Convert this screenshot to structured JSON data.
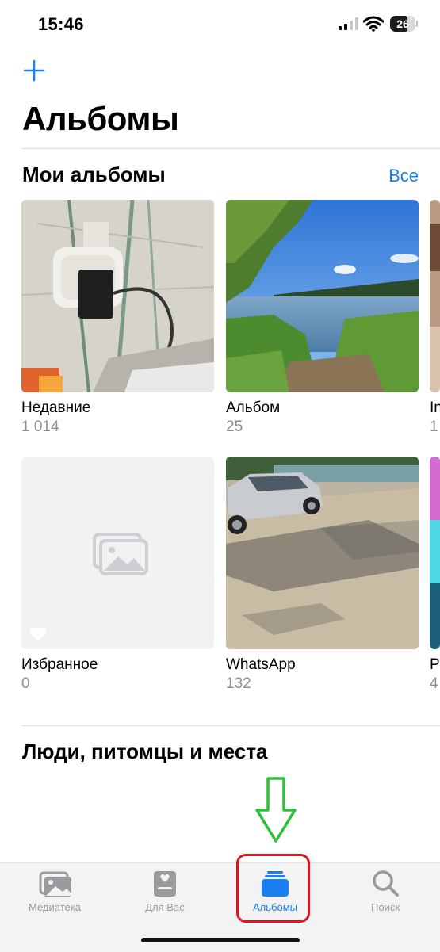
{
  "status_bar": {
    "time": "15:46",
    "battery": "26"
  },
  "header": {
    "title": "Альбомы"
  },
  "my_albums": {
    "title": "Мои альбомы",
    "see_all": "Все",
    "items": [
      {
        "name": "Недавние",
        "count": "1 014"
      },
      {
        "name": "Альбом",
        "count": "25"
      },
      {
        "name": "In",
        "count": "1"
      },
      {
        "name": "Избранное",
        "count": "0"
      },
      {
        "name": "WhatsApp",
        "count": "132"
      },
      {
        "name": "P",
        "count": "4"
      }
    ]
  },
  "people_section": {
    "title": "Люди, питомцы и места"
  },
  "tab_bar": {
    "active_color": "#1a7ff0",
    "tabs": [
      {
        "label": "Медиатека",
        "icon": "photo-library-icon"
      },
      {
        "label": "Для Вас",
        "icon": "for-you-icon"
      },
      {
        "label": "Альбомы",
        "icon": "albums-icon",
        "active": true
      },
      {
        "label": "Поиск",
        "icon": "search-icon"
      }
    ]
  },
  "annotations": {
    "arrow_color": "#2fbf3a",
    "highlight_color": "#e0141e"
  }
}
